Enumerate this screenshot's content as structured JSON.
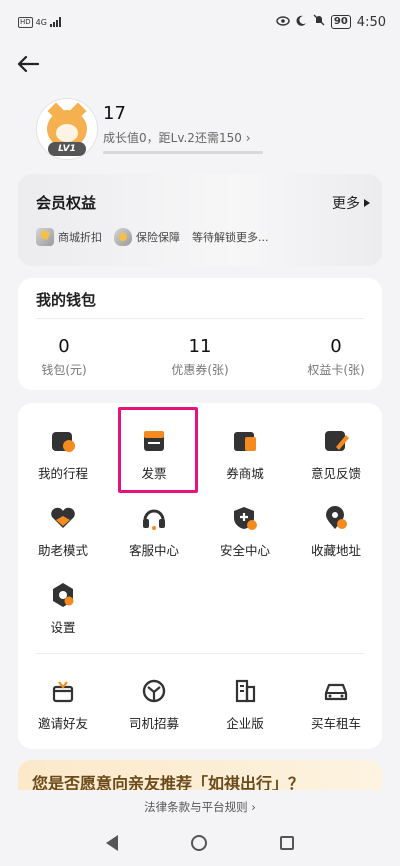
{
  "status_bar": {
    "network": "4G",
    "battery": "90",
    "time": "4:50"
  },
  "profile": {
    "username": "17",
    "level_badge": "LV1",
    "growth_text": "成长值0，距Lv.2还需150",
    "growth_progress": 0
  },
  "member": {
    "title": "会员权益",
    "more": "更多",
    "benefits": [
      "商城折扣",
      "保险保障",
      "等待解锁更多..."
    ]
  },
  "wallet": {
    "title": "我的钱包",
    "stats": [
      {
        "value": "0",
        "label": "钱包(元)"
      },
      {
        "value": "11",
        "label": "优惠券(张)"
      },
      {
        "value": "0",
        "label": "权益卡(张)"
      }
    ]
  },
  "services": {
    "row1": [
      "我的行程",
      "发票",
      "券商城",
      "意见反馈"
    ],
    "row2": [
      "助老模式",
      "客服中心",
      "安全中心",
      "收藏地址"
    ],
    "row3": [
      "设置"
    ],
    "row4": [
      "邀请好友",
      "司机招募",
      "企业版",
      "买车租车"
    ]
  },
  "highlighted_item": "发票",
  "banner": {
    "text": "您是否愿意向亲友推荐「如祺出行」？"
  },
  "footer": {
    "link": "法律条款与平台规则"
  },
  "colors": {
    "accent_orange": "#f58b1f",
    "highlight_pink": "#e8127f",
    "icon_dark": "#333333"
  }
}
